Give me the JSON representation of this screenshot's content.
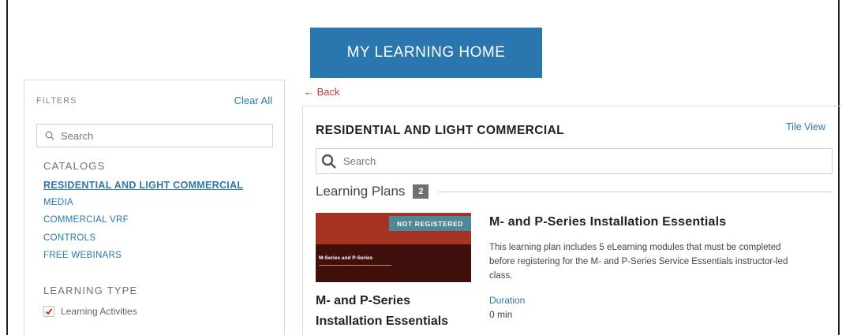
{
  "header": {
    "home_button_label": "MY LEARNING HOME"
  },
  "filters": {
    "title": "FILTERS",
    "clear_all_label": "Clear All",
    "search_placeholder": "Search",
    "catalogs_heading": "CATALOGS",
    "catalogs": [
      {
        "label": "RESIDENTIAL AND LIGHT COMMERCIAL",
        "active": true
      },
      {
        "label": "MEDIA"
      },
      {
        "label": "COMMERCIAL VRF"
      },
      {
        "label": "CONTROLS"
      },
      {
        "label": "FREE WEBINARS"
      }
    ],
    "learning_type_heading": "LEARNING TYPE",
    "learning_types": [
      {
        "label": "Learning Activities",
        "checked": true
      }
    ]
  },
  "nav": {
    "back_label": "Back"
  },
  "main": {
    "title": "RESIDENTIAL AND LIGHT COMMERCIAL",
    "tile_view_label": "Tile View",
    "search_placeholder": "Search",
    "section_label": "Learning Plans",
    "section_count": "2",
    "course": {
      "status_badge": "NOT REGISTERED",
      "thumbnail_text": "M-Series and P-Series",
      "title_left": "M- and P-Series Installation Essentials",
      "title": "M- and P-Series Installation Essentials",
      "description": "This learning plan includes 5 eLearning modules that must be completed before registering for the M- and P-Series Service Essentials instructor-led class.",
      "duration_label": "Duration",
      "duration_value": "0 min"
    }
  },
  "colors": {
    "accent": "#2a77b0",
    "back_link": "#c0392b",
    "badge": "#4e8796",
    "thumbnail": "#7a2018"
  },
  "icons": {
    "search": "search-icon",
    "back": "arrow-left-icon",
    "check": "checkmark-icon"
  }
}
